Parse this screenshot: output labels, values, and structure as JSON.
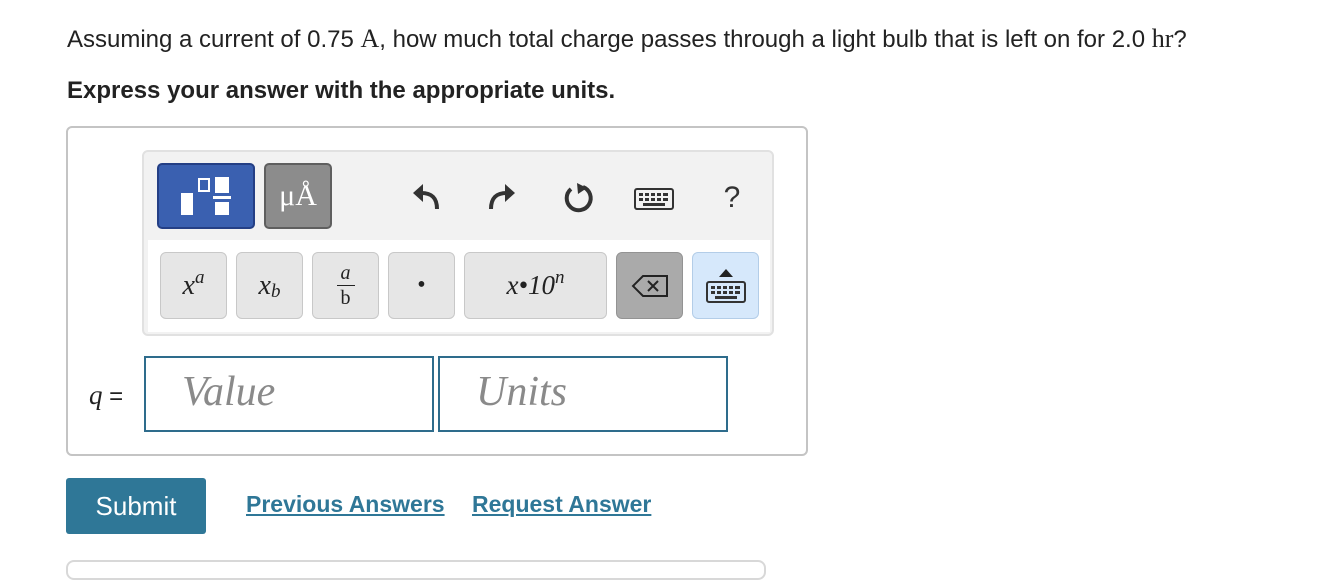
{
  "question": {
    "part1": "Assuming a current of 0.75 ",
    "current_unit": "A",
    "part2": ", how much total charge passes through a light bulb that is left on for 2.0 ",
    "time_unit": "hr",
    "part3": "?"
  },
  "instruction": "Express your answer with the appropriate units.",
  "toolbar": {
    "units_label": "μÅ",
    "help_label": "?",
    "keys": {
      "superscript_base": "x",
      "superscript_exp": "a",
      "subscript_base": "x",
      "subscript_sub": "b",
      "fraction_num": "a",
      "fraction_den": "b",
      "dot": "•",
      "sci_notation": "x•10",
      "sci_exp": "n"
    }
  },
  "answer": {
    "variable": "q",
    "equals": "=",
    "value_placeholder": "Value",
    "units_placeholder": "Units"
  },
  "actions": {
    "submit_label": "Submit",
    "previous_answers_label": "Previous Answers",
    "request_answer_label": "Request Answer"
  },
  "colors": {
    "accent": "#2f7797",
    "templates_button": "#3a60b0",
    "units_button": "#8c8c8c",
    "keyboard_toggle": "#d6e8fb"
  }
}
